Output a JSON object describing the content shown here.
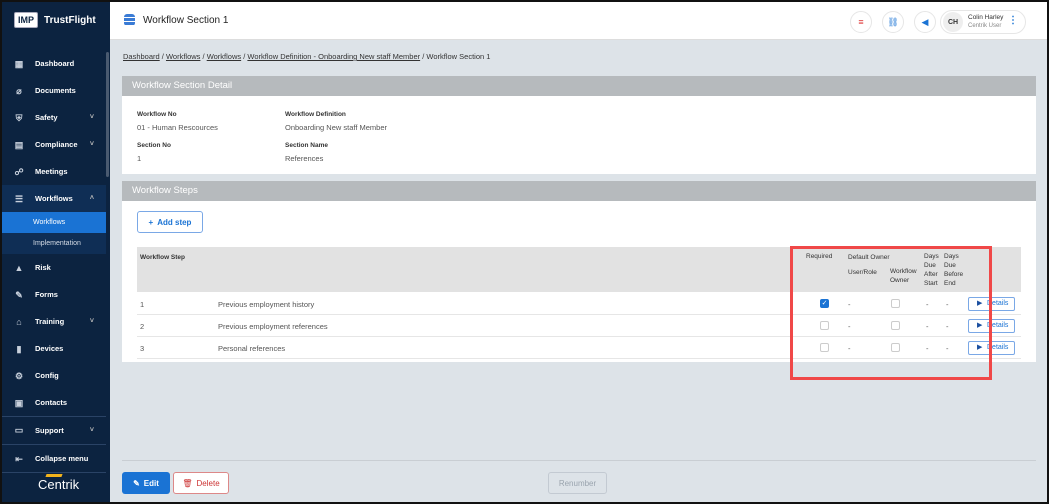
{
  "app": {
    "logo_badge": "IMP",
    "logo_name": "TrustFlight",
    "brand": "Centrik"
  },
  "sidebar": {
    "items": [
      {
        "label": "Dashboard",
        "icon": "dashboard-icon"
      },
      {
        "label": "Documents",
        "icon": "paperclip-icon"
      },
      {
        "label": "Safety",
        "icon": "shield-icon",
        "chevron": "˅"
      },
      {
        "label": "Compliance",
        "icon": "document-icon",
        "chevron": "˅"
      },
      {
        "label": "Meetings",
        "icon": "people-icon"
      },
      {
        "label": "Workflows",
        "icon": "workflow-icon",
        "chevron": "˄"
      },
      {
        "label": "Risk",
        "icon": "warning-icon"
      },
      {
        "label": "Forms",
        "icon": "form-icon"
      },
      {
        "label": "Training",
        "icon": "graduation-icon",
        "chevron": "˅"
      },
      {
        "label": "Devices",
        "icon": "device-icon"
      },
      {
        "label": "Config",
        "icon": "config-icon"
      },
      {
        "label": "Contacts",
        "icon": "contacts-icon"
      },
      {
        "label": "Support",
        "icon": "support-icon",
        "chevron": "˅"
      }
    ],
    "sub_items": [
      {
        "label": "Workflows"
      },
      {
        "label": "Implementation"
      }
    ],
    "collapse_label": "Collapse menu"
  },
  "header": {
    "title": "Workflow Section 1",
    "user_initials": "CH",
    "user_name": "Colin Harley",
    "user_role": "Centrik User"
  },
  "breadcrumb": [
    "Dashboard",
    "Workflows",
    "Workflows",
    "Workflow Definition - Onboarding New staff Member",
    "Workflow Section 1"
  ],
  "detail": {
    "title": "Workflow Section Detail",
    "workflow_no_label": "Workflow No",
    "workflow_no": "01 - Human Rescources",
    "definition_label": "Workflow Definition",
    "definition": "Onboarding New staff Member",
    "section_no_label": "Section No",
    "section_no": "1",
    "section_name_label": "Section Name",
    "section_name": "References"
  },
  "steps": {
    "title": "Workflow Steps",
    "add_label": "Add step",
    "headers": {
      "step": "Workflow Step",
      "required": "Required",
      "default_owner": "Default Owner",
      "user_role": "User/Role",
      "workflow_owner": "Workflow Owner",
      "days_after": "Days Due After Start",
      "days_before": "Days Due Before End"
    },
    "rows": [
      {
        "no": "1",
        "name": "Previous employment history",
        "required": true,
        "user_role": "-",
        "days_after": "-",
        "days_before": "-",
        "action": "Details"
      },
      {
        "no": "2",
        "name": "Previous employment references",
        "required": false,
        "user_role": "-",
        "days_after": "-",
        "days_before": "-",
        "action": "Details"
      },
      {
        "no": "3",
        "name": "Personal references",
        "required": false,
        "user_role": "-",
        "days_after": "-",
        "days_before": "-",
        "action": "Details"
      }
    ]
  },
  "footer": {
    "edit": "Edit",
    "delete": "Delete",
    "renumber": "Renumber"
  },
  "colors": {
    "sidebar": "#0c2340",
    "accent": "#1a73d4",
    "highlight": "#f04848"
  }
}
